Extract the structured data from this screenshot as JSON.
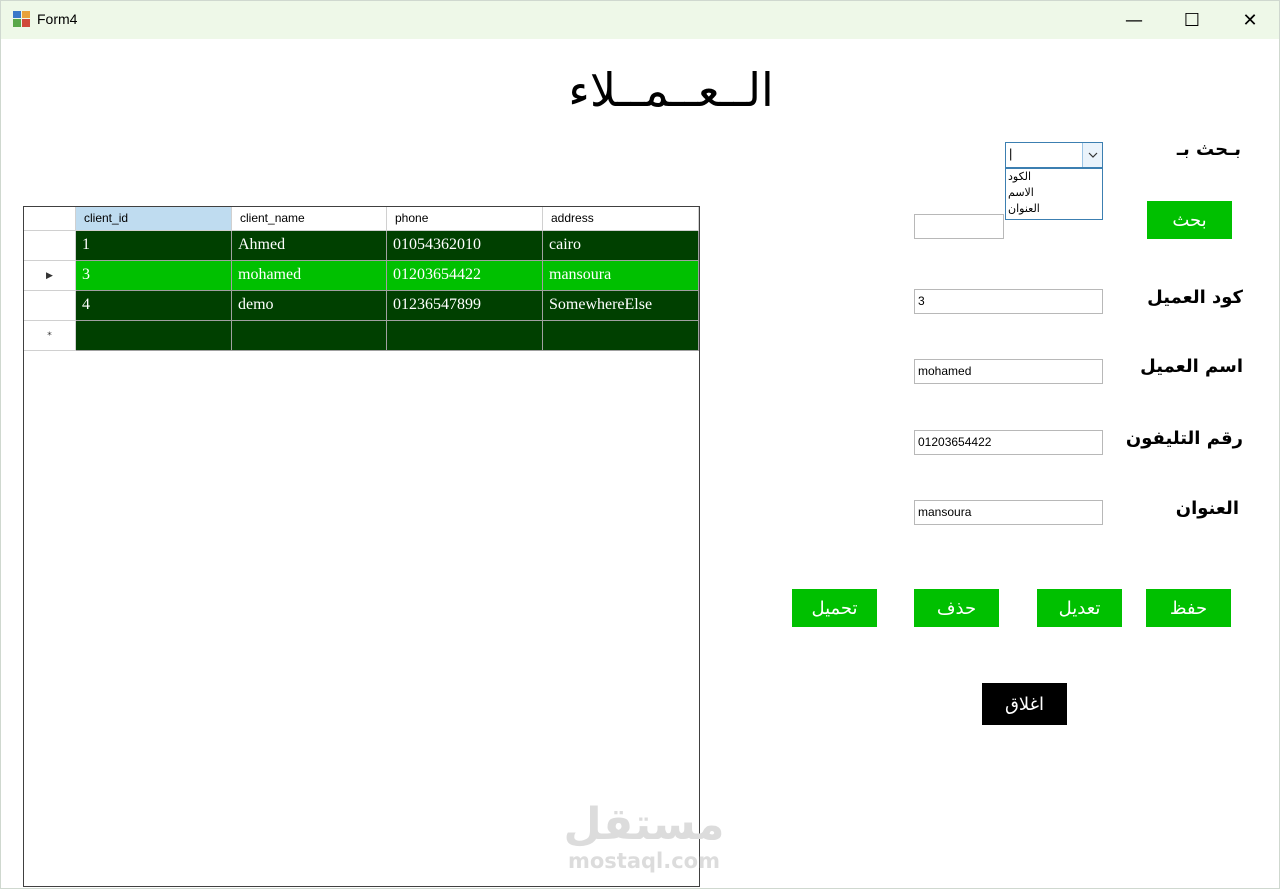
{
  "window": {
    "title": "Form4",
    "minimize": "—",
    "maximize": "☐",
    "close": "✕"
  },
  "page_title": "الــعــمــلاء",
  "search": {
    "label": "بـحث بـ",
    "combo_value": "|",
    "options": [
      "الكود",
      "الاسم",
      "العنوان"
    ],
    "input_value": "",
    "button": "بحث"
  },
  "form": {
    "code_label": "كود العميل",
    "code_value": "3",
    "name_label": "اسم العميل",
    "name_value": "mohamed",
    "phone_label": "رقم التليفون",
    "phone_value": "01203654422",
    "address_label": "العنوان",
    "address_value": "mansoura"
  },
  "buttons": {
    "save": "حفظ",
    "edit": "تعديل",
    "delete": "حذف",
    "load": "تحميل",
    "close": "اغلاق"
  },
  "grid": {
    "columns": [
      "client_id",
      "client_name",
      "phone",
      "address"
    ],
    "rows": [
      [
        "1",
        "Ahmed",
        "01054362010",
        "cairo"
      ],
      [
        "3",
        "mohamed",
        "01203654422",
        "mansoura"
      ],
      [
        "4",
        "demo",
        "01236547899",
        "SomewhereElse"
      ]
    ],
    "selected_indicator": "▶",
    "new_row_indicator": "*"
  },
  "watermark": {
    "arabic": "مستقل",
    "latin": "mostaql.com"
  },
  "colors": {
    "dark_green": "#004000",
    "bright_green": "#00c000",
    "header_selected": "#bfdcf0"
  }
}
